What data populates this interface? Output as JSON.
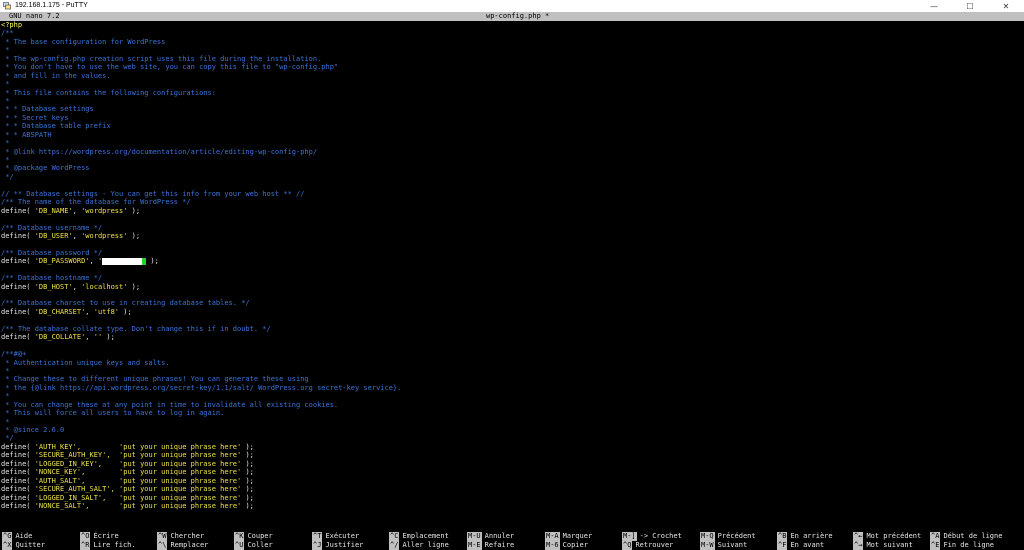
{
  "window": {
    "title": "192.168.1.175 - PuTTY",
    "icon": "putty-icon",
    "controls": {
      "minimize": "—",
      "maximize": "☐",
      "close": "✕"
    }
  },
  "nano": {
    "version": "GNU nano 7.2",
    "filename": "wp-config.php *"
  },
  "editor": {
    "lines": [
      {
        "t": "php",
        "text": "<?php"
      },
      {
        "t": "comment",
        "text": "/**"
      },
      {
        "t": "comment",
        "text": " * The base configuration for WordPress"
      },
      {
        "t": "comment",
        "text": " *"
      },
      {
        "t": "comment",
        "text": " * The wp-config.php creation script uses this file during the installation."
      },
      {
        "t": "comment",
        "text": " * You don't have to use the web site, you can copy this file to \"wp-config.php\""
      },
      {
        "t": "comment",
        "text": " * and fill in the values."
      },
      {
        "t": "comment",
        "text": " *"
      },
      {
        "t": "comment",
        "text": " * This file contains the following configurations:"
      },
      {
        "t": "comment",
        "text": " *"
      },
      {
        "t": "comment",
        "text": " * * Database settings"
      },
      {
        "t": "comment",
        "text": " * * Secret keys"
      },
      {
        "t": "comment",
        "text": " * * Database table prefix"
      },
      {
        "t": "comment",
        "text": " * * ABSPATH"
      },
      {
        "t": "comment",
        "text": " *"
      },
      {
        "t": "comment",
        "text": " * @link https://wordpress.org/documentation/article/editing-wp-config-php/"
      },
      {
        "t": "comment",
        "text": " *"
      },
      {
        "t": "comment",
        "text": " * @package WordPress"
      },
      {
        "t": "comment",
        "text": " */"
      },
      {
        "t": "blank",
        "text": ""
      },
      {
        "t": "comment",
        "text": "// ** Database settings - You can get this info from your web host ** //"
      },
      {
        "t": "comment",
        "text": "/** The name of the database for WordPress */"
      },
      {
        "t": "define",
        "pre": "define( ",
        "key": "'DB_NAME'",
        "mid": ", ",
        "val": "'wordpress'",
        "post": " );"
      },
      {
        "t": "blank",
        "text": ""
      },
      {
        "t": "comment",
        "text": "/** Database username */"
      },
      {
        "t": "define",
        "pre": "define( ",
        "key": "'DB_USER'",
        "mid": ", ",
        "val": "'wordpress'",
        "post": " );"
      },
      {
        "t": "blank",
        "text": ""
      },
      {
        "t": "comment",
        "text": "/** Database password */"
      },
      {
        "t": "password",
        "pre": "define( ",
        "key": "'DB_PASSWORD'",
        "mid": ", ",
        "val": "'",
        "post": " );"
      },
      {
        "t": "blank",
        "text": ""
      },
      {
        "t": "comment",
        "text": "/** Database hostname */"
      },
      {
        "t": "define",
        "pre": "define( ",
        "key": "'DB_HOST'",
        "mid": ", ",
        "val": "'localhost'",
        "post": " );"
      },
      {
        "t": "blank",
        "text": ""
      },
      {
        "t": "comment",
        "text": "/** Database charset to use in creating database tables. */"
      },
      {
        "t": "define",
        "pre": "define( ",
        "key": "'DB_CHARSET'",
        "mid": ", ",
        "val": "'utf8'",
        "post": " );"
      },
      {
        "t": "blank",
        "text": ""
      },
      {
        "t": "comment",
        "text": "/** The database collate type. Don't change this if in doubt. */"
      },
      {
        "t": "define",
        "pre": "define( ",
        "key": "'DB_COLLATE'",
        "mid": ", ",
        "val": "''",
        "post": " );"
      },
      {
        "t": "blank",
        "text": ""
      },
      {
        "t": "comment",
        "text": "/**#@+"
      },
      {
        "t": "comment",
        "text": " * Authentication unique keys and salts."
      },
      {
        "t": "comment",
        "text": " *"
      },
      {
        "t": "comment",
        "text": " * Change these to different unique phrases! You can generate these using"
      },
      {
        "t": "comment",
        "text": " * the {@link https://api.wordpress.org/secret-key/1.1/salt/ WordPress.org secret-key service}."
      },
      {
        "t": "comment",
        "text": " *"
      },
      {
        "t": "comment",
        "text": " * You can change these at any point in time to invalidate all existing cookies."
      },
      {
        "t": "comment",
        "text": " * This will force all users to have to log in again."
      },
      {
        "t": "comment",
        "text": " *"
      },
      {
        "t": "comment",
        "text": " * @since 2.6.0"
      },
      {
        "t": "comment",
        "text": " */"
      },
      {
        "t": "define",
        "pre": "define( ",
        "key": "'AUTH_KEY',",
        "mid": "         ",
        "val": "'put your unique phrase here'",
        "post": " );"
      },
      {
        "t": "define",
        "pre": "define( ",
        "key": "'SECURE_AUTH_KEY',",
        "mid": "  ",
        "val": "'put your unique phrase here'",
        "post": " );"
      },
      {
        "t": "define",
        "pre": "define( ",
        "key": "'LOGGED_IN_KEY',",
        "mid": "    ",
        "val": "'put your unique phrase here'",
        "post": " );"
      },
      {
        "t": "define",
        "pre": "define( ",
        "key": "'NONCE_KEY',",
        "mid": "        ",
        "val": "'put your unique phrase here'",
        "post": " );"
      },
      {
        "t": "define",
        "pre": "define( ",
        "key": "'AUTH_SALT',",
        "mid": "        ",
        "val": "'put your unique phrase here'",
        "post": " );"
      },
      {
        "t": "define",
        "pre": "define( ",
        "key": "'SECURE_AUTH_SALT',",
        "mid": " ",
        "val": "'put your unique phrase here'",
        "post": " );"
      },
      {
        "t": "define",
        "pre": "define( ",
        "key": "'LOGGED_IN_SALT',",
        "mid": "   ",
        "val": "'put your unique phrase here'",
        "post": " );"
      },
      {
        "t": "define",
        "pre": "define( ",
        "key": "'NONCE_SALT',",
        "mid": "       ",
        "val": "'put your unique phrase here'",
        "post": " );"
      }
    ]
  },
  "shortcuts": [
    {
      "key": "^G",
      "label": "Aide"
    },
    {
      "key": "^X",
      "label": "Quitter"
    },
    {
      "key": "^O",
      "label": "Écrire"
    },
    {
      "key": "^R",
      "label": "Lire fich."
    },
    {
      "key": "^W",
      "label": "Chercher"
    },
    {
      "key": "^\\",
      "label": "Remplacer"
    },
    {
      "key": "^K",
      "label": "Couper"
    },
    {
      "key": "^U",
      "label": "Coller"
    },
    {
      "key": "^T",
      "label": "Exécuter"
    },
    {
      "key": "^J",
      "label": "Justifier"
    },
    {
      "key": "^C",
      "label": "Emplacement"
    },
    {
      "key": "^/",
      "label": "Aller ligne"
    },
    {
      "key": "M-U",
      "label": "Annuler"
    },
    {
      "key": "M-E",
      "label": "Refaire"
    },
    {
      "key": "M-A",
      "label": "Marquer"
    },
    {
      "key": "M-6",
      "label": "Copier"
    },
    {
      "key": "M-]",
      "label": "-> Crochet"
    },
    {
      "key": "^Q",
      "label": "Retrouver"
    },
    {
      "key": "M-Q",
      "label": "Précédent"
    },
    {
      "key": "M-W",
      "label": "Suivant"
    },
    {
      "key": "^B",
      "label": "En arrière"
    },
    {
      "key": "^F",
      "label": "En avant"
    },
    {
      "key": "^←",
      "label": "Mot précédent"
    },
    {
      "key": "^→",
      "label": "Mot suivant"
    },
    {
      "key": "^A",
      "label": "Début de ligne"
    },
    {
      "key": "^E",
      "label": "Fin de ligne"
    }
  ]
}
